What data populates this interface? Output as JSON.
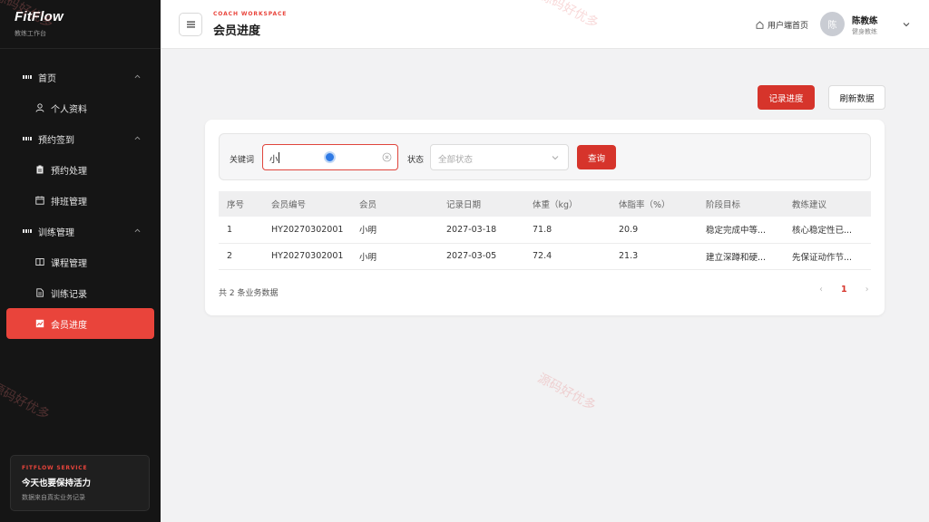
{
  "brand": {
    "title": "FitFlow",
    "subtitle": "教练工作台"
  },
  "sidebar": {
    "items": [
      {
        "label": "首页",
        "type": "group",
        "icon": "grid-icon"
      },
      {
        "label": "个人资料",
        "type": "sub",
        "icon": "user-icon"
      },
      {
        "label": "预约签到",
        "type": "group",
        "icon": "grid-icon"
      },
      {
        "label": "预约处理",
        "type": "sub",
        "icon": "clipboard-icon"
      },
      {
        "label": "排班管理",
        "type": "sub",
        "icon": "calendar-icon"
      },
      {
        "label": "训练管理",
        "type": "group",
        "icon": "grid-icon"
      },
      {
        "label": "课程管理",
        "type": "sub",
        "icon": "book-icon"
      },
      {
        "label": "训练记录",
        "type": "sub",
        "icon": "document-icon"
      },
      {
        "label": "会员进度",
        "type": "sub",
        "icon": "chart-icon",
        "active": true
      }
    ],
    "promo": {
      "tag": "FITFLOW SERVICE",
      "title": "今天也要保持活力",
      "desc": "数据来自真实业务记录"
    }
  },
  "header": {
    "tag": "COACH WORKSPACE",
    "title": "会员进度",
    "home_link": "用户端首页",
    "user": {
      "avatar": "陈",
      "name": "陈教练",
      "role": "健身教练"
    }
  },
  "actions": {
    "record": "记录进度",
    "refresh": "刷新数据"
  },
  "filter": {
    "keyword_label": "关键词",
    "keyword_value": "小",
    "status_label": "状态",
    "status_placeholder": "全部状态",
    "query": "查询"
  },
  "table": {
    "columns": [
      "序号",
      "会员编号",
      "会员",
      "记录日期",
      "体重（kg）",
      "体脂率（%）",
      "阶段目标",
      "教练建议"
    ],
    "rows": [
      [
        "1",
        "HY20270302001",
        "小明",
        "2027-03-18",
        "71.8",
        "20.9",
        "稳定完成中等...",
        "核心稳定性已..."
      ],
      [
        "2",
        "HY20270302001",
        "小明",
        "2027-03-05",
        "72.4",
        "21.3",
        "建立深蹲和硬...",
        "先保证动作节..."
      ]
    ]
  },
  "footer": {
    "total": "共 2 条业务数据",
    "page": "1",
    "prev": "‹",
    "next": "›"
  },
  "watermark": "源码好优多",
  "colors": {
    "accent": "#d6342b",
    "sidebar_bg": "#151515",
    "active_bg": "#e9443b"
  }
}
